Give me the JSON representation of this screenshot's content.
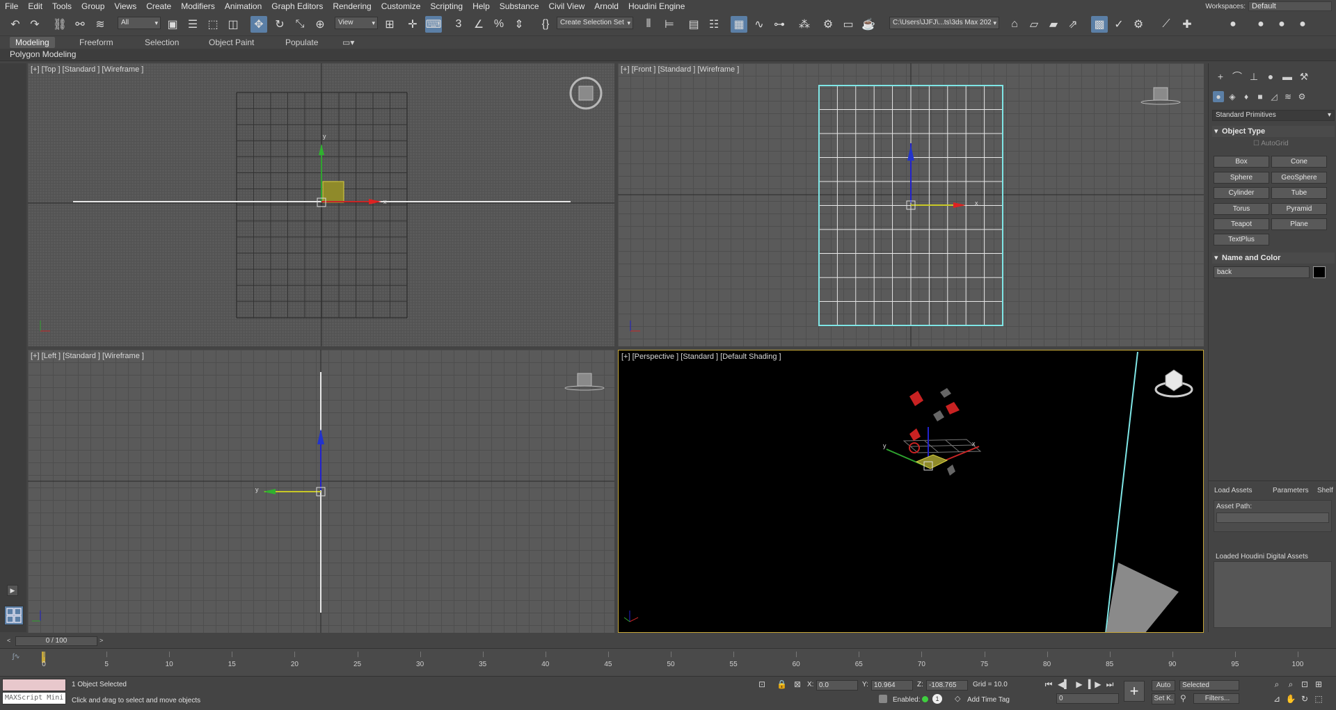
{
  "menu": [
    "File",
    "Edit",
    "Tools",
    "Group",
    "Views",
    "Create",
    "Modifiers",
    "Animation",
    "Graph Editors",
    "Rendering",
    "Customize",
    "Scripting",
    "Help",
    "Substance",
    "Civil View",
    "Arnold",
    "Houdini Engine"
  ],
  "workspaces": {
    "label": "Workspaces:",
    "value": "Default"
  },
  "toolbar": {
    "filter_value": "All",
    "ref_coord_value": "View",
    "selection_set_placeholder": "Create Selection Set",
    "project_path": "C:\\Users\\JJFJ\\...ts\\3ds Max 202"
  },
  "ribbon": {
    "tabs": [
      "Modeling",
      "Freeform",
      "Selection",
      "Object Paint",
      "Populate"
    ],
    "active": "Modeling",
    "sub_label": "Polygon Modeling"
  },
  "viewports": {
    "top": "[+] [Top ] [Standard ] [Wireframe ]",
    "front": "[+] [Front ] [Standard ] [Wireframe ]",
    "left": "[+] [Left ] [Standard ] [Wireframe ]",
    "perspective": "[+] [Perspective ] [Standard ] [Default Shading ]"
  },
  "command_panel": {
    "category": "Standard Primitives",
    "object_type_title": "Object Type",
    "autogrid": "AutoGrid",
    "primitives": [
      "Box",
      "Cone",
      "Sphere",
      "GeoSphere",
      "Cylinder",
      "Tube",
      "Torus",
      "Pyramid",
      "Teapot",
      "Plane",
      "TextPlus"
    ],
    "name_color_title": "Name and Color",
    "object_name": "back",
    "houdini_tabs": [
      "Load Assets",
      "Parameters",
      "Shelf"
    ],
    "asset_path_label": "Asset Path:",
    "loaded_assets_label": "Loaded Houdini Digital Assets"
  },
  "timeline": {
    "frame_display": "0 / 100",
    "ticks": [
      "0",
      "5",
      "10",
      "15",
      "20",
      "25",
      "30",
      "35",
      "40",
      "45",
      "50",
      "55",
      "60",
      "65",
      "70",
      "75",
      "80",
      "85",
      "90",
      "95",
      "100"
    ]
  },
  "status": {
    "maxscript": "MAXScript Mini",
    "selected": "1 Object Selected",
    "prompt": "Click and drag to select and move objects",
    "x_label": "X:",
    "x": "0.0",
    "y_label": "Y:",
    "y": "10.964",
    "z_label": "Z:",
    "z": "-108.765",
    "grid": "Grid = 10.0",
    "enabled": "Enabled:",
    "add_time_tag": "Add Time Tag",
    "auto": "Auto",
    "setk": "Set K.",
    "key_filter": "Selected",
    "current_frame": "0",
    "filters": "Filters..."
  },
  "colors": {
    "accent": "#5b7fa6",
    "selection": "#c8a93a",
    "plane_edge": "#7fe6e6"
  }
}
